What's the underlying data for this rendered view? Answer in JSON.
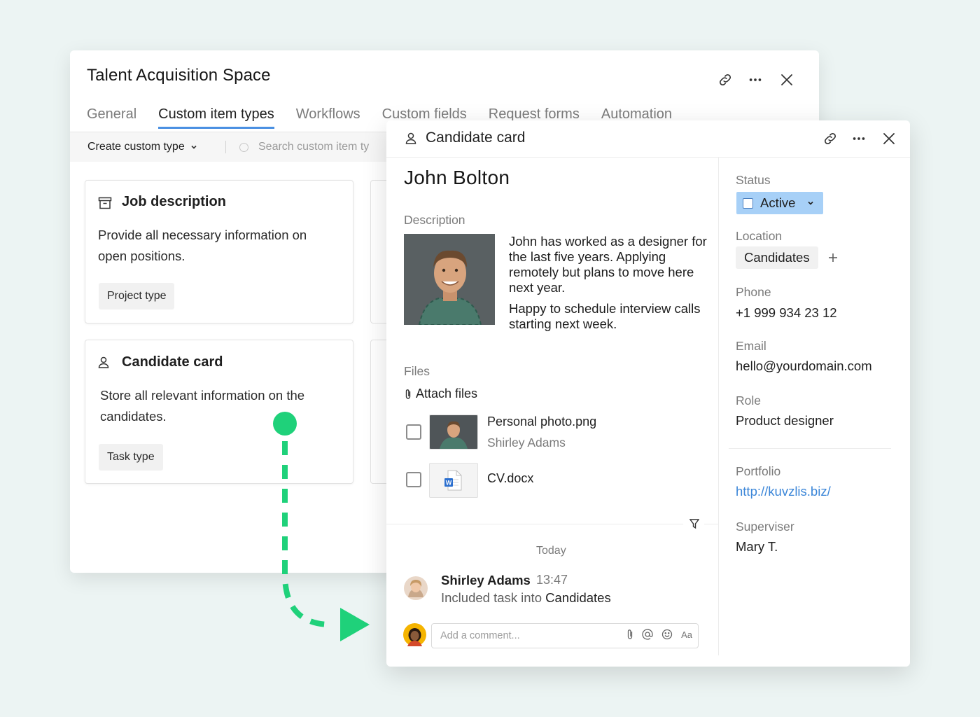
{
  "colors": {
    "accent": "#4a90e2",
    "status_bg": "#a7d0f7",
    "annotation_green": "#1fd17a",
    "link": "#3b86d8"
  },
  "back_window": {
    "title": "Talent Acquisition Space",
    "tabs": [
      {
        "label": "General",
        "active": false
      },
      {
        "label": "Custom item types",
        "active": true
      },
      {
        "label": "Workflows",
        "active": false
      },
      {
        "label": "Custom fields",
        "active": false
      },
      {
        "label": "Request forms",
        "active": false
      },
      {
        "label": "Automation",
        "active": false
      }
    ],
    "toolbar": {
      "create_label": "Create custom type",
      "search_placeholder": "Search custom item ty"
    },
    "cards": [
      {
        "title": "Job description",
        "icon": "archive-icon",
        "description": "Provide all necessary information on open positions.",
        "chip": "Project type"
      },
      {
        "title": "Candidate card",
        "icon": "person-icon",
        "description": "Store all relevant information on the candidates.",
        "chip": "Task type"
      }
    ],
    "header_icons": [
      "link-icon",
      "more-icon",
      "close-icon"
    ]
  },
  "panel": {
    "title": "Candidate card",
    "header_icons": [
      "person-icon",
      "link-icon",
      "more-icon",
      "close-icon"
    ],
    "name": "John Bolton",
    "description_label": "Description",
    "description_paragraphs": [
      "John has worked as a designer for the last five years. Applying remotely but plans to move here next year.",
      "Happy to schedule interview calls starting next week."
    ],
    "files_label": "Files",
    "attach_label": "Attach files",
    "files": [
      {
        "name": "Personal photo.png",
        "author": "Shirley Adams"
      },
      {
        "name": "CV.docx",
        "author": ""
      }
    ],
    "feed": {
      "date_label": "Today",
      "author": "Shirley Adams",
      "time": "13:47",
      "text_prefix": "Included task into",
      "text_target": "Candidates",
      "comment_placeholder": "Add a comment...",
      "comment_tools": [
        "paperclip-icon",
        "mention-icon",
        "emoji-icon",
        "format-icon"
      ],
      "format_label": "Aa"
    },
    "fields": {
      "status_label": "Status",
      "status_value": "Active",
      "location_label": "Location",
      "location_value": "Candidates",
      "phone_label": "Phone",
      "phone_value": "+1 999 934 23 12",
      "email_label": "Email",
      "email_value": "hello@yourdomain.com",
      "role_label": "Role",
      "role_value": "Product designer",
      "portfolio_label": "Portfolio",
      "portfolio_value": "http://kuvzlis.biz/",
      "supervisor_label": "Superviser",
      "supervisor_value": "Mary T."
    }
  }
}
